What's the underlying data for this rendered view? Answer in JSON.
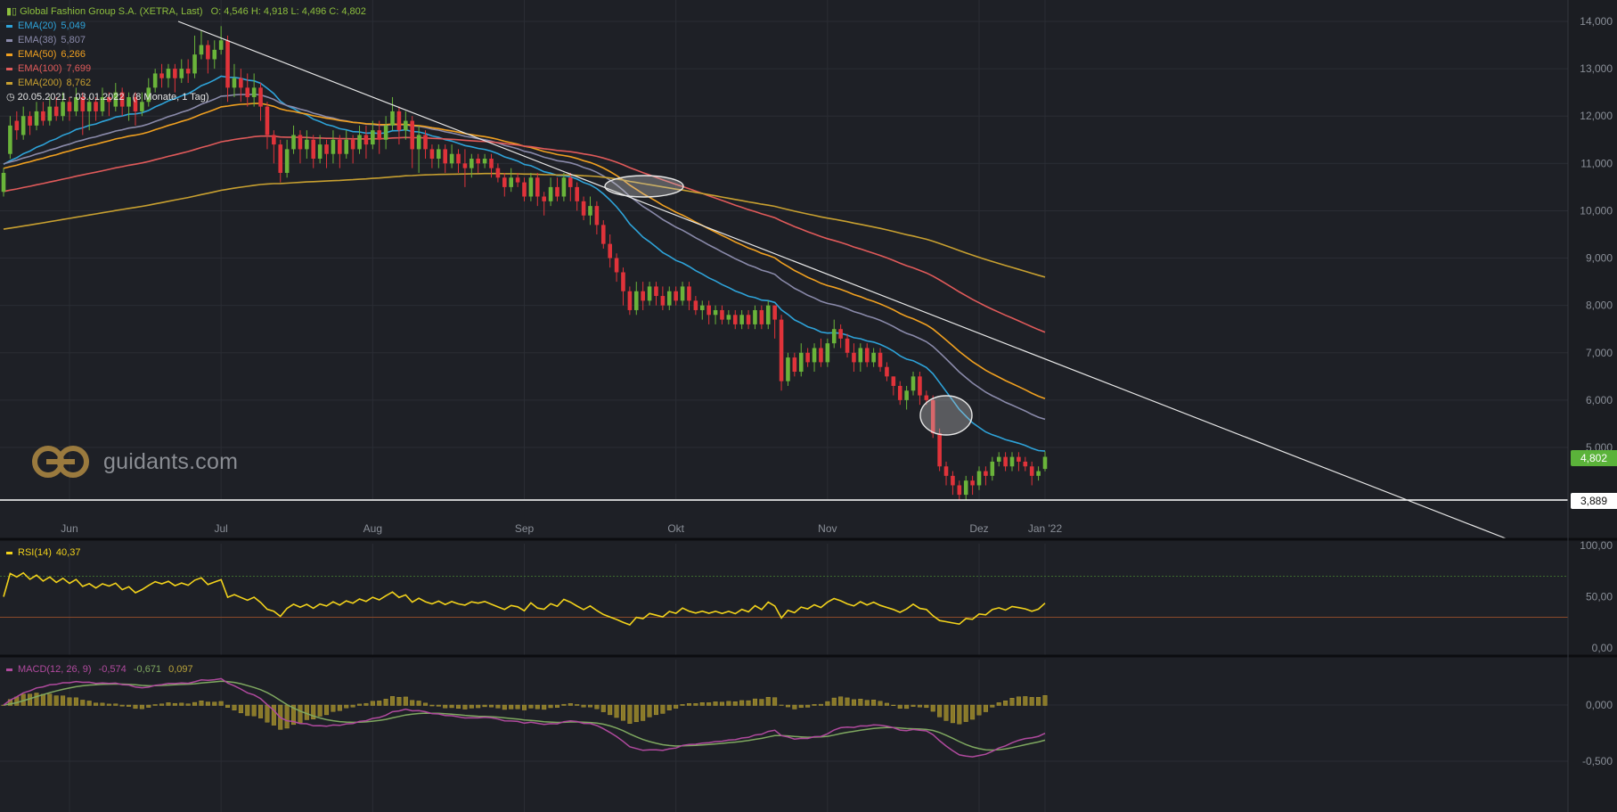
{
  "header": {
    "instrument": "Global Fashion Group S.A. (XETRA, Last)",
    "ohlc": "O: 4,546  H: 4,918  L: 4,496  C: 4,802",
    "range": "20.05.2021 - 03.01.2022",
    "interval": "(8 Monate, 1 Tag)"
  },
  "indicators": [
    {
      "label": "EMA(20)",
      "value": "5,049",
      "color": "#2ea3d9"
    },
    {
      "label": "EMA(38)",
      "value": "5,807",
      "color": "#8a8aaa"
    },
    {
      "label": "EMA(50)",
      "value": "6,266",
      "color": "#f0a020"
    },
    {
      "label": "EMA(100)",
      "value": "7,699",
      "color": "#e05a5a"
    },
    {
      "label": "EMA(200)",
      "value": "8,762",
      "color": "#c8a030"
    }
  ],
  "rsi_legend": {
    "label": "RSI(14)",
    "value": "40,37",
    "color": "#f2d21b"
  },
  "macd_legend": {
    "label": "MACD(12, 26, 9)",
    "macd": "-0,574",
    "signal": "-0,671",
    "hist": "0,097"
  },
  "logo": {
    "text": "guidants.com"
  },
  "price_tags": {
    "last": "4,802",
    "line": "3,889"
  },
  "chart_data": {
    "type": "candlestick",
    "x_labels": [
      "Jun",
      "Jul",
      "Aug",
      "Sep",
      "Okt",
      "Nov",
      "Dez",
      "Jan '22"
    ],
    "y_ticks": [
      "14,000",
      "13,000",
      "12,000",
      "11,000",
      "10,000",
      "9,000",
      "8,000",
      "7,000",
      "6,000",
      "5,000"
    ],
    "ylim": [
      3.2,
      14.5
    ],
    "rsi": {
      "ticks": [
        "100,00",
        "50,00",
        "0,00"
      ],
      "levels": [
        70,
        30
      ]
    },
    "macd": {
      "ticks": [
        "0,000",
        "-0,500"
      ]
    },
    "horizontal_line": 3.889,
    "trendline": [
      [
        1.0,
        14.0
      ],
      [
        220.0,
        3.2
      ]
    ],
    "candles": [
      [
        10.4,
        10.8,
        10.9,
        10.3
      ],
      [
        11.2,
        11.8,
        12.0,
        11.1
      ],
      [
        11.9,
        11.7,
        12.1,
        11.5
      ],
      [
        11.6,
        12.0,
        12.2,
        11.5
      ],
      [
        12.0,
        11.8,
        12.1,
        11.6
      ],
      [
        11.8,
        12.1,
        12.3,
        11.7
      ],
      [
        12.1,
        11.9,
        12.3,
        11.8
      ],
      [
        11.9,
        12.2,
        12.4,
        11.8
      ],
      [
        12.2,
        12.0,
        12.4,
        11.9
      ],
      [
        12.0,
        12.3,
        12.5,
        11.9
      ],
      [
        12.3,
        12.1,
        12.4,
        11.9
      ],
      [
        12.1,
        12.4,
        12.6,
        12.0
      ],
      [
        12.4,
        12.1,
        12.5,
        11.6
      ],
      [
        12.1,
        12.3,
        12.4,
        11.7
      ],
      [
        12.3,
        12.1,
        12.4,
        11.9
      ],
      [
        12.1,
        12.4,
        12.6,
        12.0
      ],
      [
        12.4,
        12.3,
        12.5,
        12.0
      ],
      [
        12.2,
        12.5,
        12.7,
        12.1
      ],
      [
        12.5,
        12.2,
        12.6,
        12.0
      ],
      [
        12.2,
        12.4,
        12.5,
        11.9
      ],
      [
        12.4,
        12.1,
        12.5,
        11.8
      ],
      [
        12.1,
        12.3,
        12.5,
        12.0
      ],
      [
        12.3,
        12.6,
        12.8,
        12.2
      ],
      [
        12.6,
        12.9,
        13.0,
        12.5
      ],
      [
        12.9,
        12.8,
        13.1,
        12.6
      ],
      [
        12.8,
        13.0,
        13.1,
        12.6
      ],
      [
        13.0,
        12.8,
        13.1,
        12.5
      ],
      [
        12.8,
        13.0,
        13.2,
        12.7
      ],
      [
        13.0,
        12.9,
        13.2,
        12.7
      ],
      [
        12.9,
        13.3,
        13.7,
        12.8
      ],
      [
        13.3,
        13.5,
        13.8,
        13.2
      ],
      [
        13.5,
        13.2,
        13.6,
        12.9
      ],
      [
        13.2,
        13.4,
        13.6,
        13.0
      ],
      [
        13.4,
        13.6,
        13.9,
        13.3
      ],
      [
        13.6,
        12.6,
        13.7,
        12.3
      ],
      [
        12.6,
        12.8,
        13.1,
        12.4
      ],
      [
        12.8,
        12.6,
        13.0,
        12.3
      ],
      [
        12.6,
        12.4,
        12.9,
        12.2
      ],
      [
        12.4,
        12.6,
        12.9,
        12.2
      ],
      [
        12.6,
        12.2,
        12.7,
        11.9
      ],
      [
        12.2,
        11.6,
        12.3,
        11.3
      ],
      [
        11.6,
        11.4,
        11.7,
        11.0
      ],
      [
        11.4,
        10.8,
        11.5,
        10.6
      ],
      [
        10.8,
        11.3,
        11.5,
        10.7
      ],
      [
        11.3,
        11.6,
        11.8,
        11.2
      ],
      [
        11.6,
        11.3,
        11.7,
        11.0
      ],
      [
        11.3,
        11.5,
        11.7,
        11.1
      ],
      [
        11.5,
        11.1,
        11.6,
        10.9
      ],
      [
        11.1,
        11.4,
        11.6,
        11.0
      ],
      [
        11.4,
        11.2,
        11.5,
        10.9
      ],
      [
        11.2,
        11.5,
        11.7,
        11.0
      ],
      [
        11.5,
        11.2,
        11.6,
        10.9
      ],
      [
        11.2,
        11.5,
        11.7,
        11.1
      ],
      [
        11.5,
        11.3,
        11.6,
        11.0
      ],
      [
        11.3,
        11.6,
        11.8,
        11.2
      ],
      [
        11.6,
        11.4,
        11.8,
        11.1
      ],
      [
        11.4,
        11.7,
        11.9,
        11.3
      ],
      [
        11.7,
        11.5,
        11.9,
        11.2
      ],
      [
        11.5,
        11.8,
        12.0,
        11.3
      ],
      [
        11.8,
        12.1,
        12.4,
        11.7
      ],
      [
        12.1,
        11.7,
        12.2,
        11.4
      ],
      [
        11.7,
        11.9,
        12.1,
        11.5
      ],
      [
        11.9,
        11.3,
        12.0,
        10.9
      ],
      [
        11.3,
        11.6,
        11.8,
        10.8
      ],
      [
        11.6,
        11.3,
        11.7,
        11.1
      ],
      [
        11.3,
        11.1,
        11.4,
        10.9
      ],
      [
        11.1,
        11.3,
        11.4,
        10.9
      ],
      [
        11.3,
        11.0,
        11.4,
        10.8
      ],
      [
        11.0,
        11.2,
        11.4,
        10.9
      ],
      [
        11.2,
        11.0,
        11.3,
        10.8
      ],
      [
        11.0,
        10.9,
        11.3,
        10.5
      ],
      [
        10.9,
        11.1,
        11.2,
        10.7
      ],
      [
        11.1,
        11.0,
        11.2,
        10.8
      ],
      [
        11.0,
        11.1,
        11.2,
        10.9
      ],
      [
        11.1,
        10.9,
        11.2,
        10.7
      ],
      [
        10.9,
        10.7,
        11.0,
        10.6
      ],
      [
        10.7,
        10.5,
        10.8,
        10.3
      ],
      [
        10.5,
        10.7,
        10.9,
        10.4
      ],
      [
        10.7,
        10.6,
        10.8,
        10.5
      ],
      [
        10.6,
        10.3,
        10.7,
        10.2
      ],
      [
        10.3,
        10.7,
        10.8,
        10.2
      ],
      [
        10.7,
        10.3,
        10.8,
        10.1
      ],
      [
        10.3,
        10.2,
        10.4,
        9.9
      ],
      [
        10.2,
        10.5,
        10.7,
        10.1
      ],
      [
        10.5,
        10.3,
        10.7,
        10.2
      ],
      [
        10.3,
        10.7,
        10.8,
        10.2
      ],
      [
        10.7,
        10.5,
        10.8,
        10.2
      ],
      [
        10.5,
        10.2,
        10.6,
        10.0
      ],
      [
        10.2,
        9.9,
        10.3,
        9.8
      ],
      [
        9.9,
        10.1,
        10.3,
        9.7
      ],
      [
        10.1,
        9.7,
        10.2,
        9.5
      ],
      [
        9.7,
        9.3,
        9.8,
        9.2
      ],
      [
        9.3,
        9.0,
        9.5,
        8.8
      ],
      [
        9.0,
        8.7,
        9.1,
        8.5
      ],
      [
        8.7,
        8.3,
        8.8,
        8.0
      ],
      [
        8.3,
        7.9,
        8.4,
        7.8
      ],
      [
        7.9,
        8.3,
        8.5,
        7.8
      ],
      [
        8.3,
        8.1,
        8.5,
        7.9
      ],
      [
        8.1,
        8.4,
        8.5,
        8.0
      ],
      [
        8.4,
        8.2,
        8.5,
        8.0
      ],
      [
        8.2,
        8.0,
        8.4,
        7.9
      ],
      [
        8.0,
        8.3,
        8.4,
        7.9
      ],
      [
        8.3,
        8.1,
        8.4,
        8.0
      ],
      [
        8.1,
        8.4,
        8.5,
        8.0
      ],
      [
        8.4,
        8.1,
        8.5,
        7.9
      ],
      [
        8.1,
        7.9,
        8.2,
        7.8
      ],
      [
        7.9,
        8.0,
        8.1,
        7.7
      ],
      [
        8.0,
        7.8,
        8.1,
        7.6
      ],
      [
        7.8,
        7.9,
        8.0,
        7.6
      ],
      [
        7.9,
        7.7,
        8.0,
        7.6
      ],
      [
        7.7,
        7.8,
        7.9,
        7.6
      ],
      [
        7.8,
        7.6,
        7.9,
        7.5
      ],
      [
        7.6,
        7.8,
        7.9,
        7.5
      ],
      [
        7.8,
        7.6,
        7.9,
        7.5
      ],
      [
        7.6,
        7.9,
        8.0,
        7.5
      ],
      [
        7.9,
        7.6,
        8.0,
        7.5
      ],
      [
        7.6,
        8.0,
        8.1,
        7.5
      ],
      [
        8.0,
        7.7,
        8.0,
        7.3
      ],
      [
        7.7,
        6.4,
        7.8,
        6.2
      ],
      [
        6.4,
        6.9,
        7.0,
        6.3
      ],
      [
        6.9,
        6.6,
        7.0,
        6.5
      ],
      [
        6.6,
        7.0,
        7.2,
        6.5
      ],
      [
        7.0,
        6.8,
        7.1,
        6.7
      ],
      [
        6.8,
        7.1,
        7.2,
        6.6
      ],
      [
        7.1,
        6.8,
        7.3,
        6.7
      ],
      [
        6.8,
        7.2,
        7.3,
        6.7
      ],
      [
        7.2,
        7.5,
        7.7,
        7.1
      ],
      [
        7.5,
        7.3,
        7.6,
        7.1
      ],
      [
        7.3,
        7.0,
        7.4,
        6.9
      ],
      [
        7.0,
        6.8,
        7.2,
        6.6
      ],
      [
        6.8,
        7.1,
        7.2,
        6.6
      ],
      [
        7.1,
        6.8,
        7.2,
        6.7
      ],
      [
        6.8,
        7.0,
        7.1,
        6.7
      ],
      [
        7.0,
        6.7,
        7.1,
        6.6
      ],
      [
        6.7,
        6.5,
        6.8,
        6.4
      ],
      [
        6.5,
        6.3,
        6.5,
        6.1
      ],
      [
        6.3,
        6.0,
        6.4,
        5.9
      ],
      [
        6.0,
        6.2,
        6.3,
        5.8
      ],
      [
        6.2,
        6.5,
        6.6,
        6.1
      ],
      [
        6.5,
        6.1,
        6.6,
        5.9
      ],
      [
        6.1,
        6.0,
        6.2,
        5.9
      ],
      [
        6.0,
        5.3,
        6.1,
        5.2
      ],
      [
        5.3,
        4.6,
        5.4,
        4.5
      ],
      [
        4.6,
        4.4,
        4.7,
        4.2
      ],
      [
        4.4,
        4.2,
        4.5,
        4.0
      ],
      [
        4.2,
        4.0,
        4.3,
        3.9
      ],
      [
        4.0,
        4.3,
        4.4,
        3.9
      ],
      [
        4.3,
        4.2,
        4.4,
        4.0
      ],
      [
        4.2,
        4.5,
        4.6,
        4.1
      ],
      [
        4.5,
        4.4,
        4.6,
        4.2
      ],
      [
        4.4,
        4.7,
        4.8,
        4.3
      ],
      [
        4.7,
        4.8,
        4.9,
        4.6
      ],
      [
        4.8,
        4.6,
        4.9,
        4.5
      ],
      [
        4.6,
        4.8,
        4.9,
        4.5
      ],
      [
        4.8,
        4.7,
        4.9,
        4.5
      ],
      [
        4.7,
        4.6,
        4.8,
        4.5
      ],
      [
        4.6,
        4.4,
        4.7,
        4.2
      ],
      [
        4.4,
        4.5,
        4.6,
        4.3
      ],
      [
        4.546,
        4.802,
        4.918,
        4.496
      ]
    ]
  }
}
